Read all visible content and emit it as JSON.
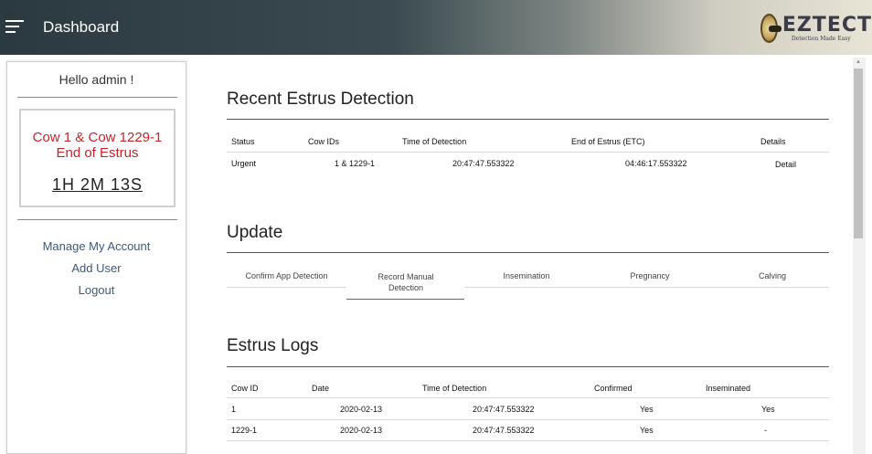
{
  "header": {
    "title": "Dashboard",
    "logo_text": "EZTECT",
    "logo_tagline": "Detection Made Easy"
  },
  "sidebar": {
    "greeting": "Hello admin !",
    "alert": {
      "line1": "Cow 1 & Cow 1229-1",
      "line2": "End of Estrus",
      "countdown": "1H 2M 13S"
    },
    "links": [
      "Manage My Account",
      "Add User",
      "Logout"
    ]
  },
  "recent": {
    "title": "Recent Estrus Detection",
    "headers": [
      "Status",
      "Cow IDs",
      "Time of Detection",
      "End of Estrus (ETC)",
      "Details"
    ],
    "rows": [
      {
        "status": "Urgent",
        "cow_ids": "1 & 1229-1",
        "time": "20:47:47.553322",
        "end": "04:46:17.553322",
        "detail": "Detail"
      }
    ]
  },
  "update": {
    "title": "Update",
    "tabs": [
      "Confirm App Detection",
      "Record Manual Detection",
      "Insemination",
      "Pregnancy",
      "Calving"
    ],
    "tab_record_line1": "Record Manual",
    "tab_record_line2": "Detection"
  },
  "logs": {
    "title": "Estrus Logs",
    "headers": [
      "Cow ID",
      "Date",
      "Time of Detection",
      "Confirmed",
      "Inseminated"
    ],
    "rows": [
      {
        "cow_id": "1",
        "date": "2020-02-13",
        "time": "20:47:47.553322",
        "confirmed": "Yes",
        "inseminated": "Yes"
      },
      {
        "cow_id": "1229-1",
        "date": "2020-02-13",
        "time": "20:47:47.553322",
        "confirmed": "Yes",
        "inseminated": "-"
      }
    ]
  },
  "colors": {
    "alert": "#c0272d",
    "link": "#3c5a77",
    "header_dark": "#2b3a40"
  }
}
